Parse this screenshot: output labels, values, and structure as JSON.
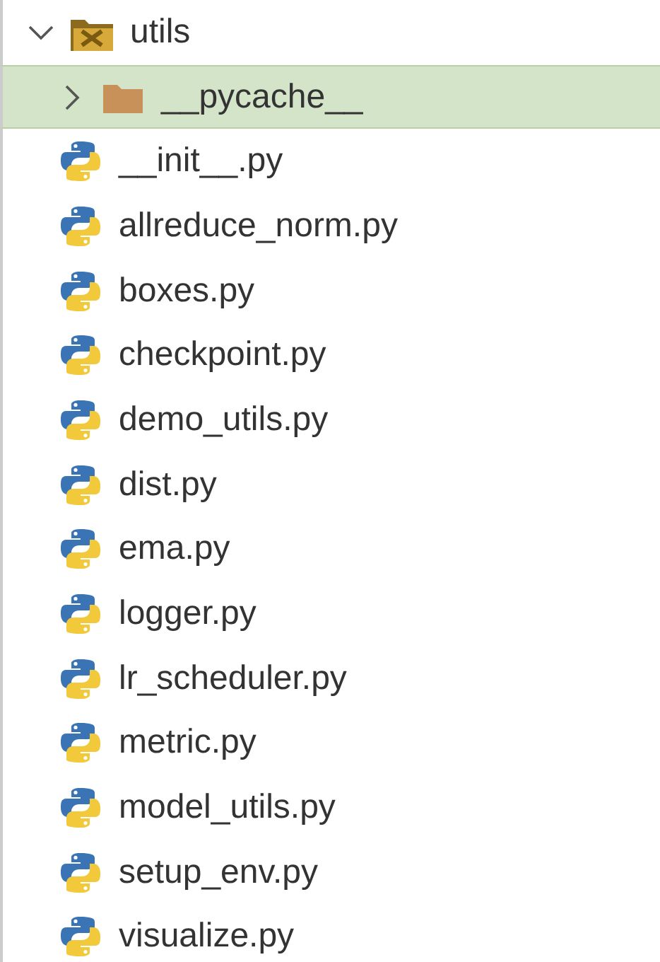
{
  "tree": {
    "label": "utils",
    "kind": "package",
    "expanded": true,
    "selected": false,
    "children": [
      {
        "label": "__pycache__",
        "kind": "folder",
        "expanded": false,
        "selected": true
      },
      {
        "label": "__init__.py",
        "kind": "file",
        "selected": false
      },
      {
        "label": "allreduce_norm.py",
        "kind": "file",
        "selected": false
      },
      {
        "label": "boxes.py",
        "kind": "file",
        "selected": false
      },
      {
        "label": "checkpoint.py",
        "kind": "file",
        "selected": false
      },
      {
        "label": "demo_utils.py",
        "kind": "file",
        "selected": false
      },
      {
        "label": "dist.py",
        "kind": "file",
        "selected": false
      },
      {
        "label": "ema.py",
        "kind": "file",
        "selected": false
      },
      {
        "label": "logger.py",
        "kind": "file",
        "selected": false
      },
      {
        "label": "lr_scheduler.py",
        "kind": "file",
        "selected": false
      },
      {
        "label": "metric.py",
        "kind": "file",
        "selected": false
      },
      {
        "label": "model_utils.py",
        "kind": "file",
        "selected": false
      },
      {
        "label": "setup_env.py",
        "kind": "file",
        "selected": false
      },
      {
        "label": "visualize.py",
        "kind": "file",
        "selected": false
      }
    ]
  }
}
